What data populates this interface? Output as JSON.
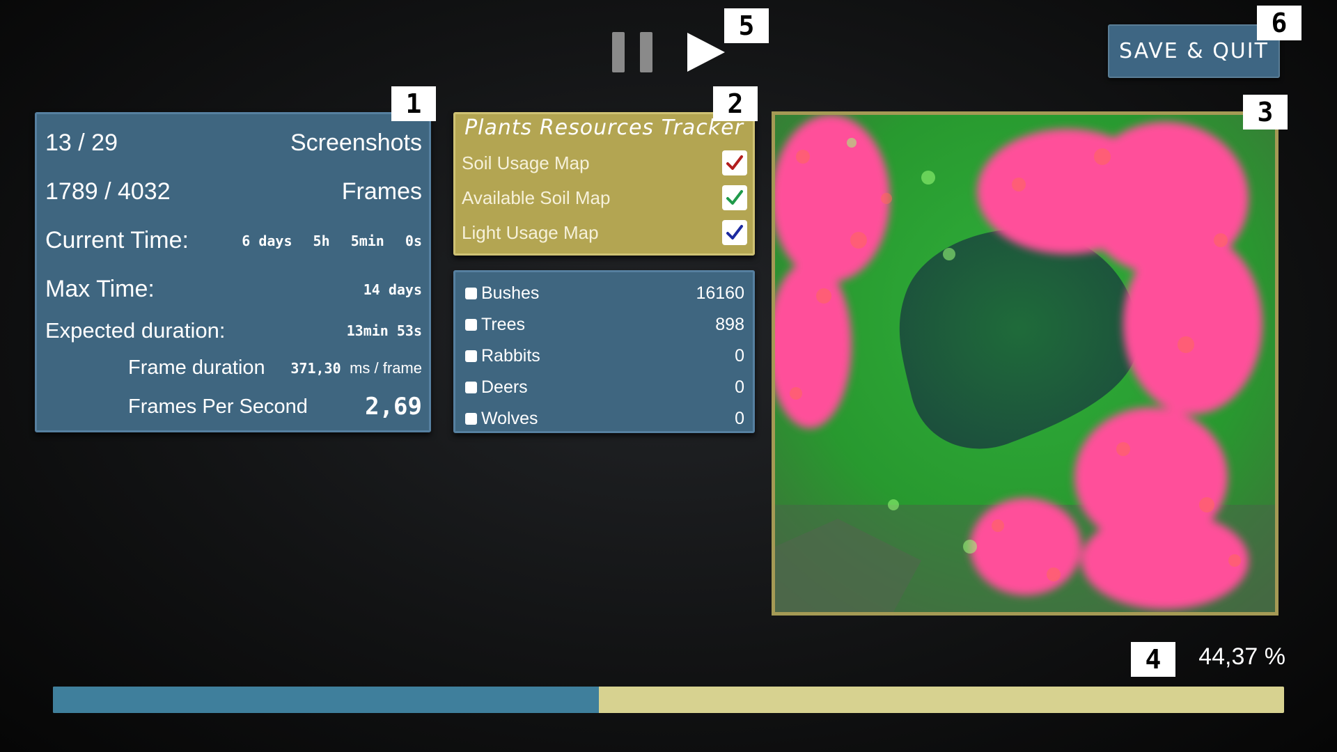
{
  "tags": {
    "t1": "1",
    "t2": "2",
    "t3": "3",
    "t4": "4",
    "t5": "5",
    "t6": "6"
  },
  "controls": {
    "pause_icon": "pause-icon",
    "play_icon": "play-icon",
    "save_quit_label": "SAVE & QUIT"
  },
  "stats": {
    "screenshots_value": "13 / 29",
    "screenshots_label": "Screenshots",
    "frames_value": "1789 / 4032",
    "frames_label": "Frames",
    "current_time_label": "Current Time:",
    "current_time_days": "6 days",
    "current_time_hours": "5h",
    "current_time_minutes": "5min",
    "current_time_seconds": "0s",
    "max_time_label": "Max Time:",
    "max_time_value": "14 days",
    "expected_duration_label": "Expected duration:",
    "expected_duration_value": "13min 53s",
    "frame_duration_label": "Frame duration",
    "frame_duration_value": "371,30",
    "frame_duration_unit": "ms / frame",
    "fps_label": "Frames Per Second",
    "fps_value": "2,69"
  },
  "plants_tracker": {
    "title": "Plants Resources Tracker",
    "maps": [
      {
        "label": "Soil Usage Map",
        "checked": true,
        "check_color": "#b21e1e"
      },
      {
        "label": "Available Soil Map",
        "checked": true,
        "check_color": "#1f9a4a"
      },
      {
        "label": "Light Usage Map",
        "checked": true,
        "check_color": "#1c2aa0"
      }
    ]
  },
  "species": [
    {
      "name": "Bushes",
      "count": "16160"
    },
    {
      "name": "Trees",
      "count": "898"
    },
    {
      "name": "Rabbits",
      "count": "0"
    },
    {
      "name": "Deers",
      "count": "0"
    },
    {
      "name": "Wolves",
      "count": "0"
    }
  ],
  "progress": {
    "percent_text": "44,37 %",
    "fraction": 0.4437,
    "fill_color": "#3f7f9c",
    "track_color": "#d7d290"
  },
  "colors": {
    "panel_blue": "#3f6680",
    "panel_gold": "#b3a552",
    "map_green": "#1f7a2e",
    "map_pink": "#ff4f9a",
    "map_border": "#a59a55"
  }
}
